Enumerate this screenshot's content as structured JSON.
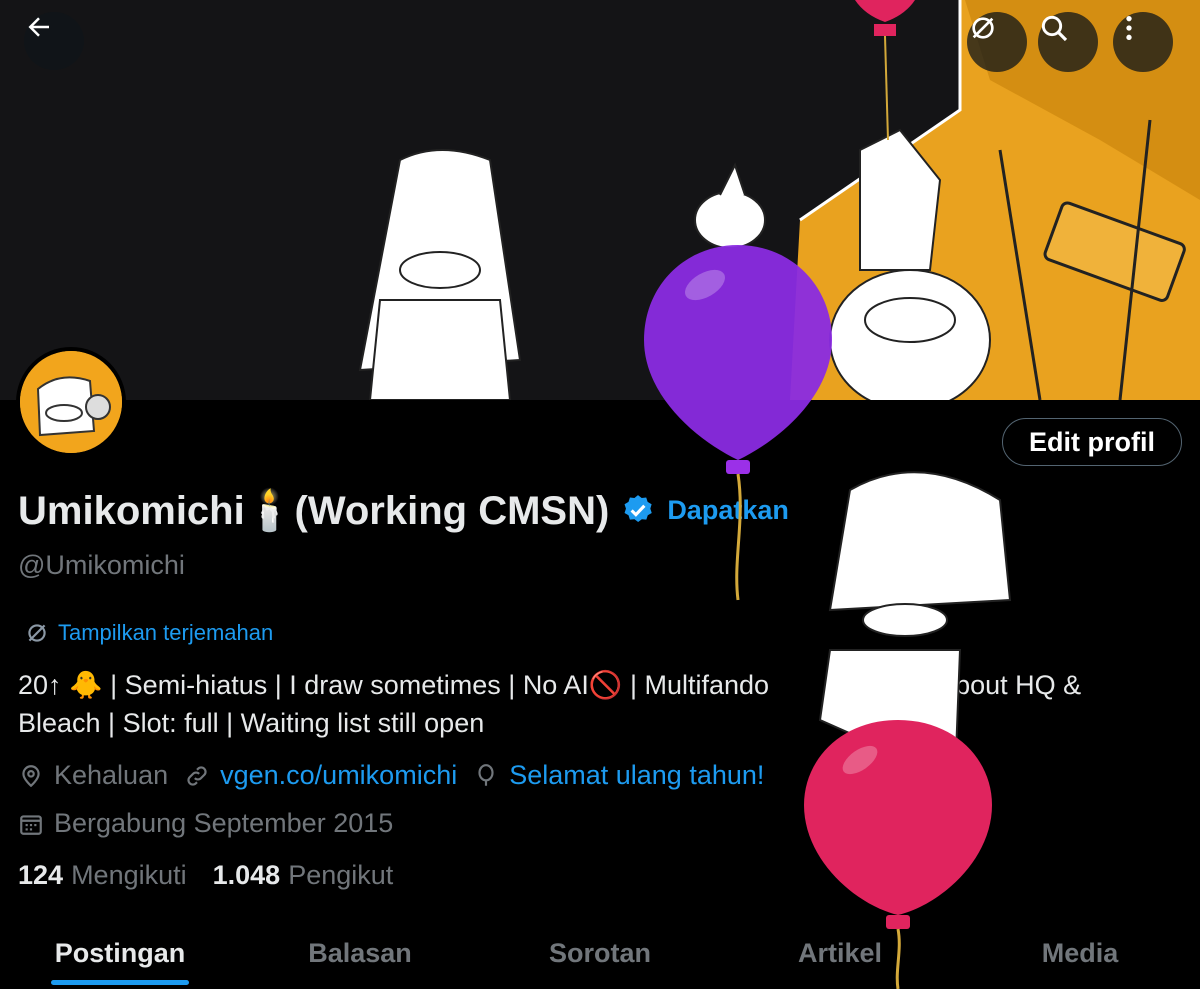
{
  "header": {
    "back_icon": "arrow-left-icon",
    "actions": [
      {
        "name": "translate-icon"
      },
      {
        "name": "search-icon"
      },
      {
        "name": "more-vertical-icon"
      }
    ]
  },
  "profile": {
    "display_name": "Umikomichi🕯️(Working CMSN)",
    "get_verified_label": "Dapatkan",
    "handle": "@Umikomichi",
    "edit_button": "Edit profil",
    "translate_label": "Tampilkan terjemahan",
    "bio_line1": "20↑ 🐥 | Semi-hiatus | I draw sometimes | No AI🚫 | Multifando",
    "bio_line1_tail": "y about HQ &",
    "bio_line2": "Bleach | Slot: full | Waiting list still open",
    "location": "Kehaluan",
    "website": "vgen.co/umikomichi",
    "birthday": "Selamat ulang tahun!",
    "joined": "Bergabung September 2015",
    "following_count": "124",
    "following_label": "Mengikuti",
    "followers_count": "1.048",
    "followers_label": "Pengikut"
  },
  "tabs": [
    {
      "label": "Postingan",
      "active": true
    },
    {
      "label": "Balasan",
      "active": false
    },
    {
      "label": "Sorotan",
      "active": false
    },
    {
      "label": "Artikel",
      "active": false
    },
    {
      "label": "Media",
      "active": false
    }
  ],
  "colors": {
    "background": "#000000",
    "accent": "#1d9bf0",
    "muted": "#71767b",
    "avatar_bg": "#f2a51c",
    "balloon_purple": "#8a2be2",
    "balloon_red": "#e0245e"
  }
}
